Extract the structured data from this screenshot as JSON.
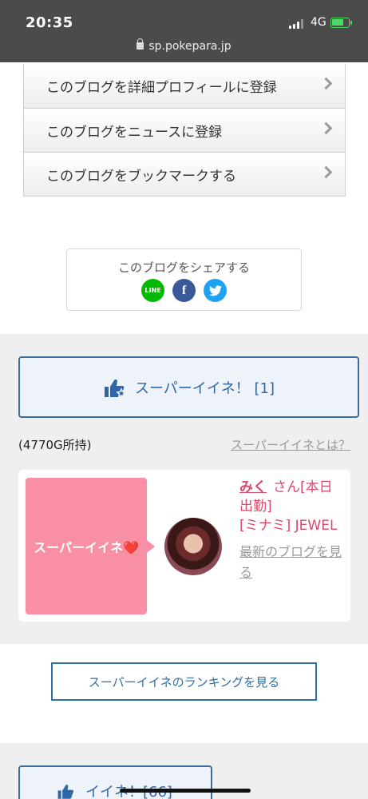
{
  "status_bar": {
    "time": "20:35",
    "network": "4G",
    "url": "sp.pokepara.jp"
  },
  "menu": {
    "items": [
      {
        "label": "このブログを詳細プロフィールに登録"
      },
      {
        "label": "このブログをニュースに登録"
      },
      {
        "label": "このブログをブックマークする"
      }
    ]
  },
  "share": {
    "title": "このブログをシェアする",
    "line_label": "LINE",
    "facebook_label": "f"
  },
  "super_iine": {
    "button_label": "スーパーイイネ！ [1]",
    "coins": "(4770G所持)",
    "what_link": "スーパーイイネとは？",
    "card": {
      "badge": "スーパーイイネ❤️",
      "name": "みく",
      "suffix": "さん[本日出勤]",
      "shop": "[ミナミ] JEWEL",
      "blog_link": "最新のブログを見る"
    }
  },
  "ranking": {
    "button_label": "スーパーイイネのランキングを見る"
  },
  "iine": {
    "button_label": "イイネ！[66]"
  },
  "colors": {
    "accent_blue": "#2e67a8",
    "pink": "#f88fa5",
    "name_pink": "#d84a6b"
  }
}
